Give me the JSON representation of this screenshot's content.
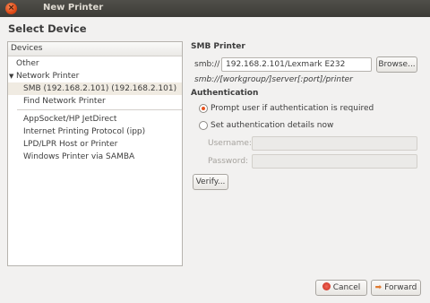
{
  "window": {
    "title": "New Printer"
  },
  "heading": "Select Device",
  "devices": {
    "header": "Devices",
    "items": [
      {
        "label": "Other"
      },
      {
        "label": "Network Printer"
      },
      {
        "label": "SMB (192.168.2.101) (192.168.2.101)"
      },
      {
        "label": "Find Network Printer"
      },
      {
        "label": "AppSocket/HP JetDirect"
      },
      {
        "label": "Internet Printing Protocol (ipp)"
      },
      {
        "label": "LPD/LPR Host or Printer"
      },
      {
        "label": "Windows Printer via SAMBA"
      }
    ]
  },
  "smb": {
    "title": "SMB Printer",
    "prefix": "smb://",
    "value": "192.168.2.101/Lexmark E232",
    "browse_label": "Browse...",
    "hint": "smb://[workgroup/]server[:port]/printer"
  },
  "auth": {
    "title": "Authentication",
    "option1": "Prompt user if authentication is required",
    "option2": "Set authentication details now",
    "username_label": "Username:",
    "password_label": "Password:",
    "verify_label": "Verify..."
  },
  "footer": {
    "cancel_label": "Cancel",
    "forward_label": "Forward"
  },
  "colors": {
    "accent": "#e95420",
    "selection": "#f0ebe2",
    "background": "#f2f1f0"
  }
}
